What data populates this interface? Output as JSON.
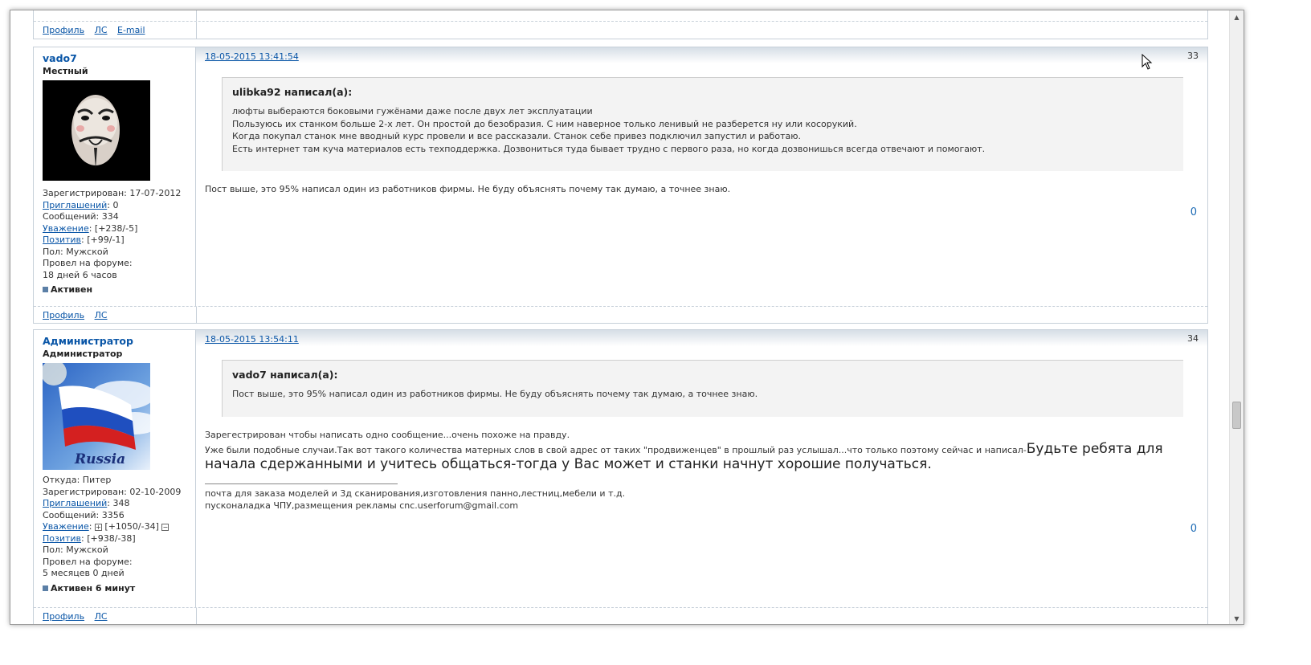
{
  "top_post": {
    "links": [
      "Профиль",
      "ЛС",
      "E-mail"
    ]
  },
  "post33": {
    "username": "vado7",
    "rank": "Местный",
    "registered": "Зарегистрирован: 17-07-2012",
    "invites_label": "Приглашений",
    "invites_value": ": 0",
    "messages": "Сообщений: 334",
    "respect_label": "Уважение",
    "respect_value": ": [+238/-5]",
    "positive_label": "Позитив",
    "positive_value": ": [+99/-1]",
    "gender": "Пол: Мужской",
    "time_label": "Провел на форуме:",
    "time_value": "18 дней 6 часов",
    "status": "Активен",
    "date": "18-05-2015 13:41:54",
    "number": "33",
    "quote_author": "ulibka92 написал(а):",
    "quote_lines": [
      "люфты выбераются боковыми гужёнами даже после двух лет эксплуатации",
      "Пользуюсь их станком больше 2-х лет. Он простой до безобразия. С ним наверное только ленивый не разберется ну или косорукий.",
      "Когда покупал станок мне вводный курс провели и все рассказали. Станок себе привез подключил запустил и работаю.",
      "Есть интернет там куча материалов есть техподдержка. Дозвониться туда бывает трудно с первого раза, но когда дозвонишься всегда отвечают и помогают."
    ],
    "body": "Пост выше, это 95% написал один из работников фирмы. Не буду объяснять почему так думаю, а точнее знаю.",
    "rep": "0",
    "links": [
      "Профиль",
      "ЛС"
    ]
  },
  "post34": {
    "username": "Администратор",
    "rank": "Администратор",
    "avatar_text": "Russia",
    "from": "Откуда: Питер",
    "registered": "Зарегистрирован: 02-10-2009",
    "invites_label": "Приглашений",
    "invites_value": ": 348",
    "messages": "Сообщений: 3356",
    "respect_label": "Уважение",
    "respect_value": "[+1050/-34]",
    "positive_label": "Позитив",
    "positive_value": ": [+938/-38]",
    "gender": "Пол: Мужской",
    "time_label": "Провел на форуме:",
    "time_value": "5 месяцев 0 дней",
    "status": "Активен 6 минут",
    "date": "18-05-2015 13:54:11",
    "number": "34",
    "quote_author": "vado7 написал(а):",
    "quote_line": "Пост выше, это 95% написал один из работников фирмы. Не буду объяснять почему так думаю, а точнее знаю.",
    "body_line1": "Зарегестрирован чтобы написать одно сообщение...очень похоже на правду.",
    "body_line2_small": "Уже были подобные случаи.Так вот такого количества матерных слов в свой адрес от таких \"продвиженцев\" в прошлый раз услышал...что только поэтому сейчас и написал-",
    "body_line2_big": "Будьте ребята для начала сдержанными и учитесь общаться-тогда у Вас может и станки начнут хорошие получаться.",
    "sig_line1": "почта для заказа моделей и 3д сканирования,изготовления панно,лестниц,мебели и т.д.",
    "sig_line2": "пусконаладка ЧПУ,размещения рекламы cnc.userforum@gmail.com",
    "rep": "0",
    "links": [
      "Профиль",
      "ЛС"
    ]
  }
}
